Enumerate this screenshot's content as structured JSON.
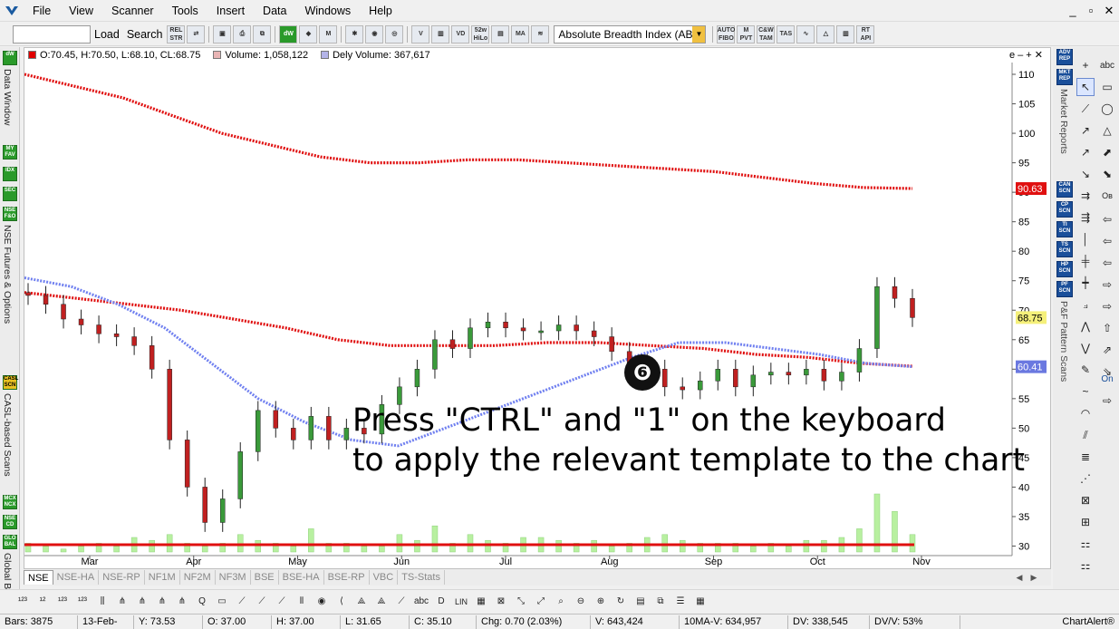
{
  "menu": [
    "File",
    "View",
    "Scanner",
    "Tools",
    "Insert",
    "Data",
    "Windows",
    "Help"
  ],
  "window_controls": [
    "_",
    "▫",
    "✕"
  ],
  "toolbar": {
    "load_label": "Load",
    "search_label": "Search",
    "icon_labels": [
      "REL STR",
      "52w HiLo",
      "MA",
      "AUTO FIBO",
      "M PVT",
      "C&W TAM",
      "TAS",
      "RT API"
    ],
    "indicator_select": "Absolute Breadth Index (ABI"
  },
  "left_rail": {
    "labels": [
      "Data Window",
      "NSE Futures & Options",
      "CASL-based Scans",
      "Global B"
    ],
    "buttons": [
      "dW",
      "MY FAV",
      "IDX",
      "SEC",
      "NSE F&O",
      "CASL SCN",
      "MCX NCX",
      "NSE CD",
      "GLO BAL"
    ]
  },
  "legend": {
    "ohlc": "O:70.45, H:70.50, L:68.10, CL:68.75",
    "volume": "Volume: 1,058,122",
    "dely_volume": "Dely Volume: 367,617",
    "window_buttons": "e – + ✕"
  },
  "colors": {
    "ohlc_swatch": "#e00000",
    "volume_swatch": "#e8b4b4",
    "dely_swatch": "#b4b4e8",
    "ma_red": "#e01010",
    "ma_blue": "#7080f0",
    "up_candle": "#3a9a3a",
    "down_candle": "#c02020",
    "volume_bar": "#b8f0a0"
  },
  "price_tags": {
    "ma200": "90.63",
    "close": "68.75",
    "ma50": "60.41"
  },
  "chart_data": {
    "type": "candlestick",
    "y_ticks": [
      30,
      35,
      40,
      45,
      50,
      55,
      60,
      65,
      70,
      75,
      80,
      85,
      90,
      95,
      100,
      105,
      110
    ],
    "ylim": [
      29,
      112
    ],
    "x_ticks": [
      "Mar",
      "Apr",
      "May",
      "Jun",
      "Jul",
      "Aug",
      "Sep",
      "Oct",
      "Nov"
    ],
    "close_series": [
      72.5,
      71,
      68.5,
      67.5,
      66,
      65.5,
      64,
      60,
      48,
      40,
      34,
      38,
      46,
      53,
      50,
      48,
      52,
      48,
      50,
      49,
      54,
      57,
      60,
      65,
      63.5,
      67,
      68,
      67,
      66.5,
      66.5,
      67.5,
      66.5,
      65.5,
      63,
      61,
      60,
      57,
      56.5,
      58,
      60,
      57,
      59,
      59.5,
      59,
      60,
      58,
      59.5,
      63.5,
      74,
      72,
      68.75
    ],
    "ma_red_high": [
      110,
      108,
      106,
      103,
      100,
      98,
      96,
      95,
      95,
      95.5,
      95.5,
      95,
      94.5,
      94,
      93.5,
      92.5,
      91.5,
      90.8,
      90.63
    ],
    "ma_red_low": [
      73,
      72,
      71,
      70,
      68.5,
      67,
      65,
      64,
      64,
      64,
      64.5,
      64.5,
      64,
      63.5,
      62.5,
      62,
      61,
      60.5
    ],
    "ma_blue": [
      75.5,
      74,
      71,
      67,
      61,
      55,
      51,
      48,
      47,
      50,
      53,
      56,
      59,
      62,
      64.5,
      64.5,
      63.5,
      62.5,
      61,
      60.41
    ]
  },
  "overlay": {
    "step": "❻",
    "line1": "Press \"CTRL\" and \"1\" on the keyboard",
    "line2": "to apply the relevant template to the chart"
  },
  "right_panel": {
    "labels": [
      "Market Reports",
      "P&F Pattern Scans"
    ],
    "buttons": [
      "ADV REP",
      "MKT REP",
      "CAN SCN",
      "CP SCN",
      "TI SCN",
      "TS SCN",
      "HP SCN",
      "PF SCN"
    ],
    "tools": [
      "abc",
      "Ов",
      "On"
    ]
  },
  "tabs": [
    "NSE",
    "NSE-HA",
    "NSE-RP",
    "NF1M",
    "NF2M",
    "NF3M",
    "BSE",
    "BSE-HA",
    "BSE-RP",
    "VBC",
    "TS-Stats"
  ],
  "status": {
    "bars": "Bars: 3875",
    "date": "13-Feb-",
    "y": "Y: 73.53",
    "o": "O: 37.00",
    "h": "H: 37.00",
    "l": "L: 31.65",
    "c": "C: 35.10",
    "chg": "Chg: 0.70 (2.03%)",
    "v": "V: 643,424",
    "ma_v": "10MA-V: 634,957",
    "dv": "DV: 338,545",
    "dvv": "DV/V: 53%",
    "brand": "ChartAlert®"
  }
}
